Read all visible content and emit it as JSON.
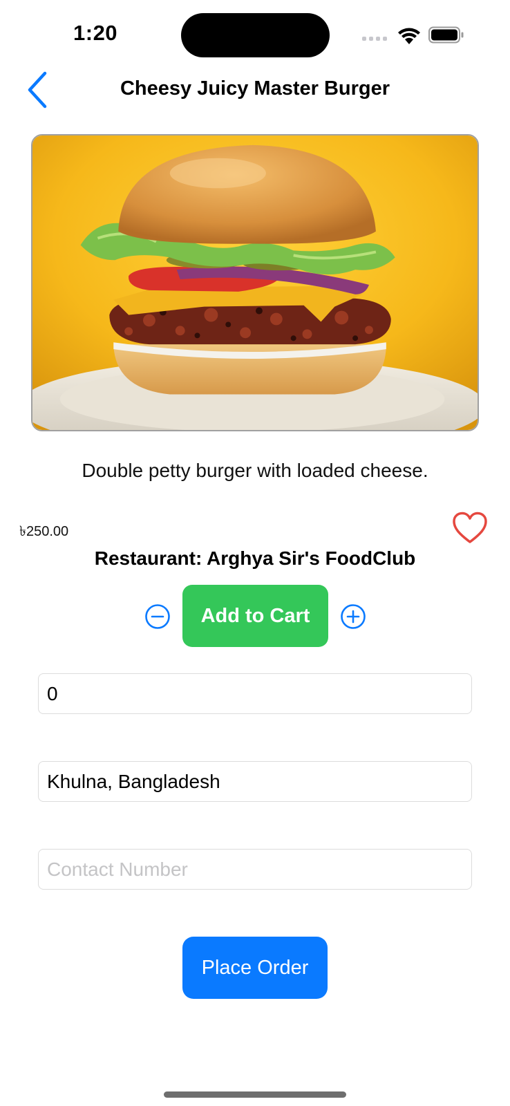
{
  "status_bar": {
    "time": "1:20"
  },
  "nav": {
    "title": "Cheesy Juicy Master Burger",
    "back_icon": "chevron-left-icon"
  },
  "product": {
    "description": "Double petty burger with loaded cheese.",
    "price": "৳250.00",
    "restaurant": "Restaurant: Arghya Sir's FoodClub",
    "favorite": false
  },
  "cart": {
    "add_label": "Add to Cart",
    "minus_icon": "minus-circle-icon",
    "plus_icon": "plus-circle-icon"
  },
  "form": {
    "quantity_value": "0",
    "address_value": "Khulna, Bangladesh",
    "contact_placeholder": "Contact Number"
  },
  "actions": {
    "place_order_label": "Place Order"
  },
  "colors": {
    "accent_blue": "#0a7aff",
    "add_to_cart_green": "#34c759",
    "heart_red": "#e5483f"
  }
}
